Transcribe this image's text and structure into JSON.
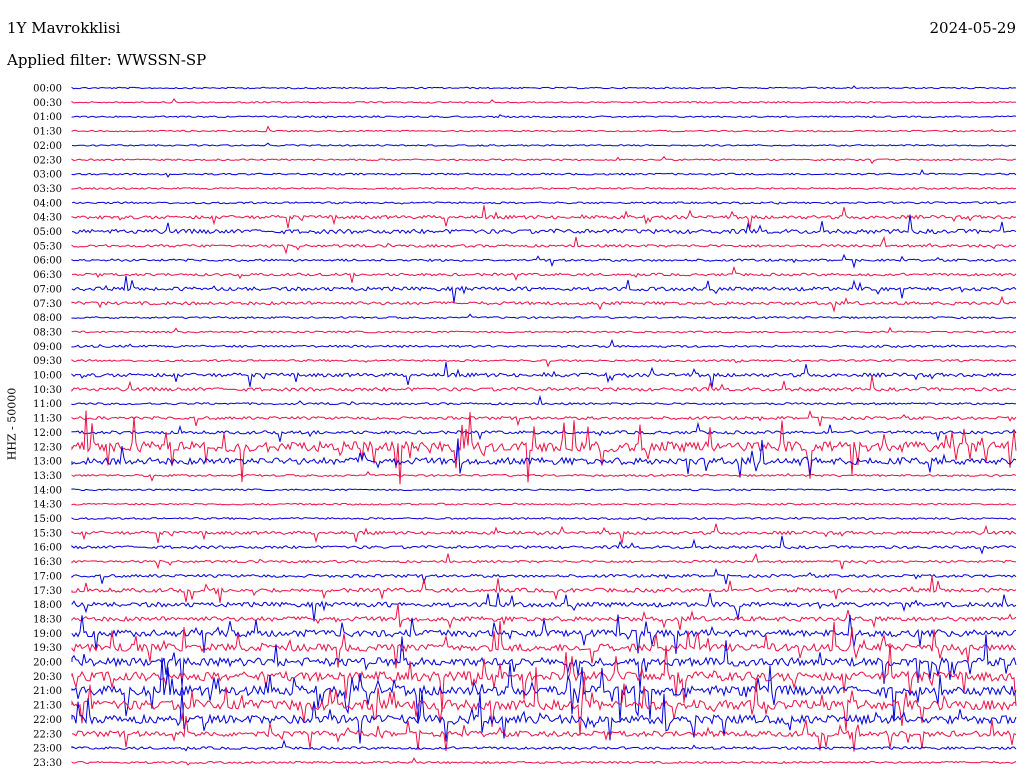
{
  "header": {
    "station": "1Y Mavrokklisi",
    "date": "2024-05-29",
    "filter_label": "Applied filter:",
    "filter_value": "WWSSN-SP"
  },
  "chart_data": {
    "type": "line",
    "ylabel": "HHZ - 50000",
    "trace_colors": [
      "#0000dd",
      "#ee1144"
    ],
    "row_labels": [
      "00:00",
      "00:30",
      "01:00",
      "01:30",
      "02:00",
      "02:30",
      "03:00",
      "03:30",
      "04:00",
      "04:30",
      "05:00",
      "05:30",
      "06:00",
      "06:30",
      "07:00",
      "07:30",
      "08:00",
      "08:30",
      "09:00",
      "09:30",
      "10:00",
      "10:30",
      "11:00",
      "11:30",
      "12:00",
      "12:30",
      "13:00",
      "13:30",
      "14:00",
      "14:30",
      "15:00",
      "15:30",
      "16:00",
      "16:30",
      "17:00",
      "17:30",
      "18:00",
      "18:30",
      "19:00",
      "19:30",
      "20:00",
      "20:30",
      "21:00",
      "21:30",
      "22:00",
      "22:30",
      "23:00",
      "23:30"
    ],
    "activity": [
      0.1,
      0.1,
      0.15,
      0.1,
      0.1,
      0.15,
      0.2,
      0.2,
      0.25,
      0.8,
      1.1,
      0.5,
      0.4,
      0.5,
      0.9,
      0.7,
      0.25,
      0.2,
      0.35,
      0.3,
      0.9,
      0.8,
      0.3,
      0.6,
      0.7,
      3.2,
      2.0,
      0.3,
      0.15,
      0.2,
      0.25,
      0.7,
      0.6,
      0.4,
      0.6,
      1.0,
      1.2,
      1.2,
      2.0,
      2.2,
      2.5,
      2.8,
      3.0,
      3.0,
      2.6,
      1.6,
      0.5,
      0.3
    ]
  }
}
